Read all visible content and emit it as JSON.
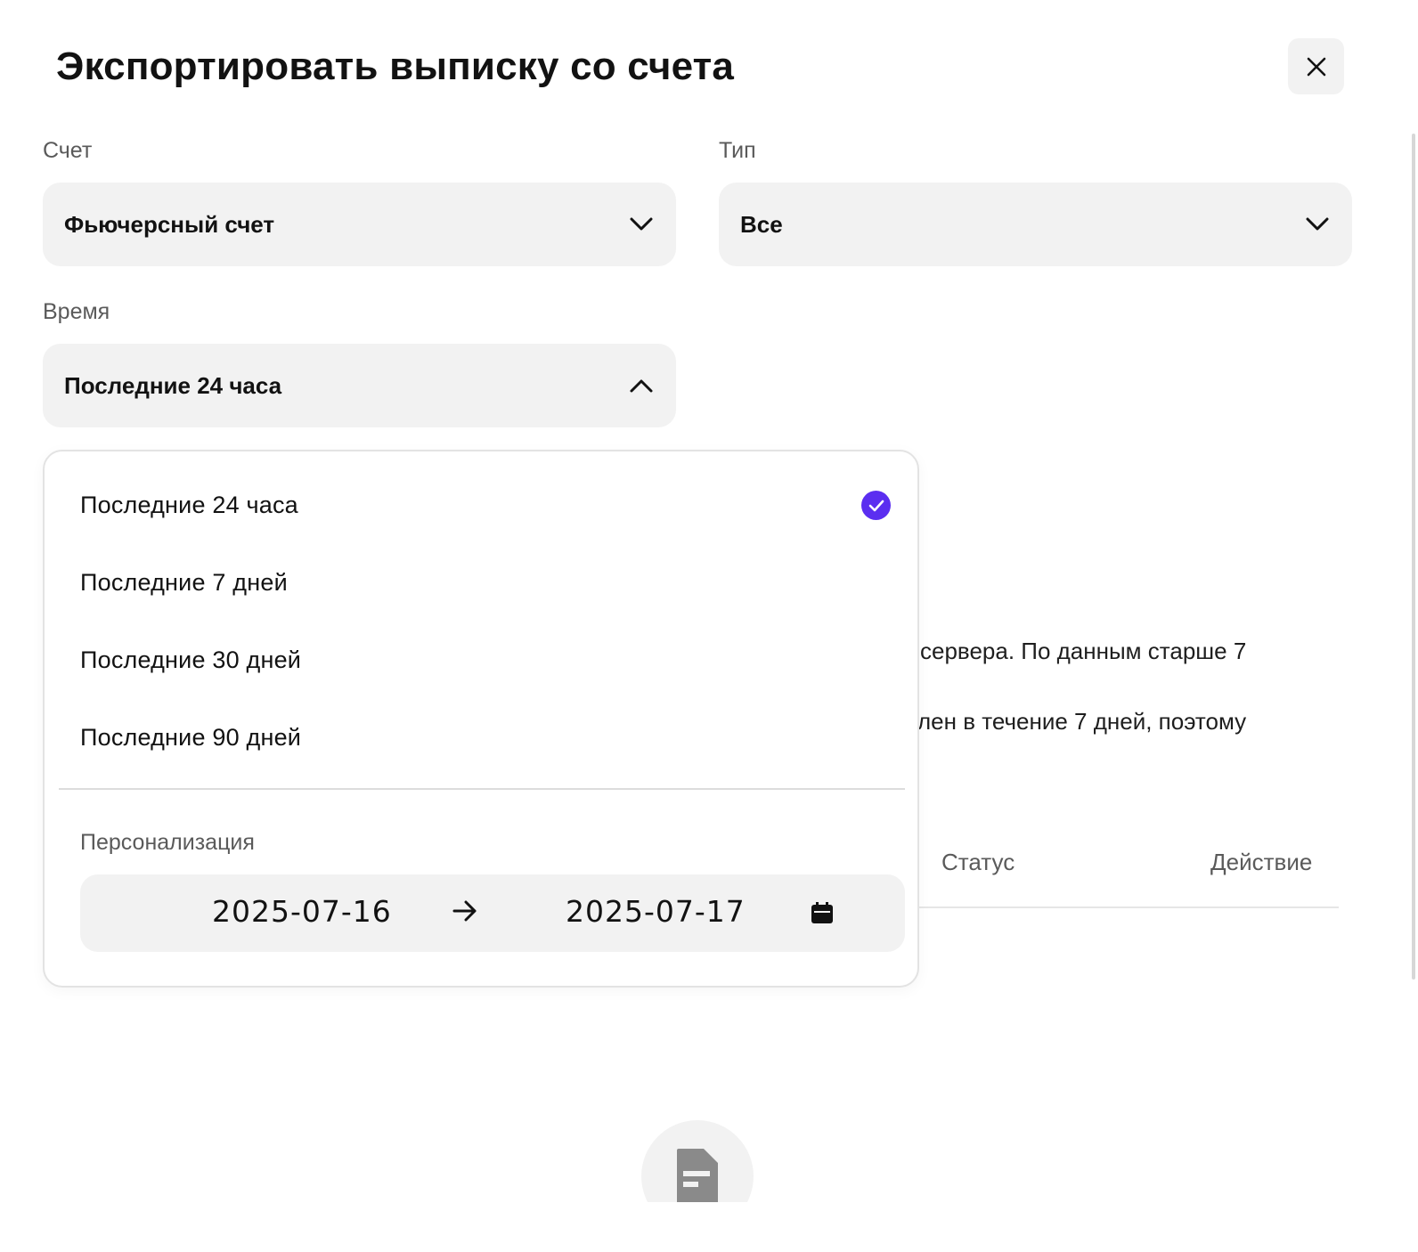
{
  "dialog": {
    "title": "Экспортировать выписку со счета",
    "close_icon": "close-icon"
  },
  "account": {
    "label": "Счет",
    "value": "Фьючерсный счет",
    "icon": "chevron-down-icon"
  },
  "type": {
    "label": "Тип",
    "value": "Все",
    "icon": "chevron-down-icon"
  },
  "time": {
    "label": "Время",
    "value": "Последние 24 часа",
    "icon": "chevron-up-icon",
    "expanded": true
  },
  "time_options": [
    {
      "label": "Последние 24 часа",
      "selected": true
    },
    {
      "label": "Последние 7 дней",
      "selected": false
    },
    {
      "label": "Последние 30 дней",
      "selected": false
    },
    {
      "label": "Последние 90 дней",
      "selected": false
    }
  ],
  "custom_range": {
    "label": "Персонализация",
    "start": "2025-07-16",
    "end": "2025-07-17",
    "arrow_icon": "arrow-right-icon",
    "calendar_icon": "calendar-icon"
  },
  "notice": {
    "line1": "сервера. По данным старше 7",
    "line2": "лен в течение 7 дней, поэтому"
  },
  "table": {
    "headers": [
      "Статус",
      "Действие"
    ]
  },
  "empty_state": {
    "icon": "document-icon"
  },
  "colors": {
    "accent": "#5b2ef0",
    "field_bg": "#f2f2f2",
    "text": "#121212",
    "muted": "#5a5a5a"
  }
}
